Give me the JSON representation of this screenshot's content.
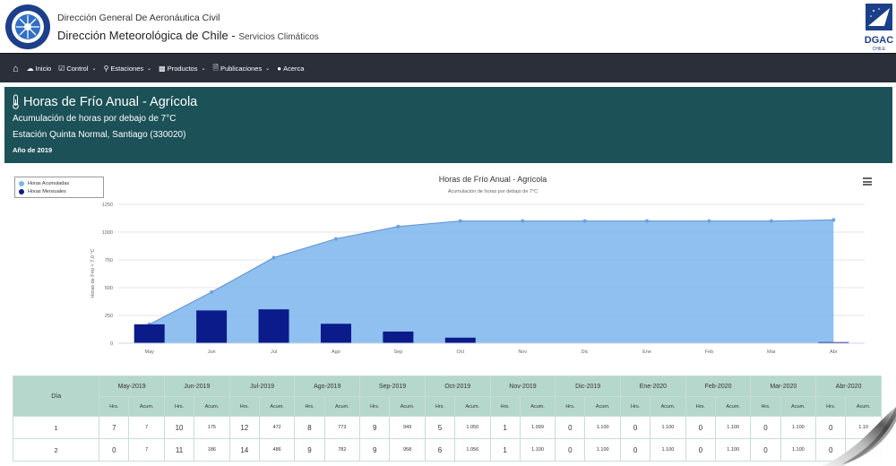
{
  "header": {
    "org_line1": "Dirección General De Aeronáutica Civil",
    "org_line2": "Dirección Meteorológica de Chile",
    "org_sep": " - ",
    "services": "Servicios Climáticos",
    "right_logo_text": "DGAC",
    "right_logo_sub": "CHILE"
  },
  "nav": {
    "items": [
      {
        "label": "Inicio",
        "icon": "cloud-icon",
        "dropdown": false
      },
      {
        "label": "Control",
        "icon": "check-square-icon",
        "dropdown": true
      },
      {
        "label": "Estaciones",
        "icon": "map-marker-icon",
        "dropdown": true
      },
      {
        "label": "Productos",
        "icon": "bar-chart-icon",
        "dropdown": true
      },
      {
        "label": "Publicaciones",
        "icon": "file-icon",
        "dropdown": true
      },
      {
        "label": "Acerca",
        "icon": "comment-icon",
        "dropdown": false
      }
    ]
  },
  "banner": {
    "title": "Horas de Frío Anual - Agrícola",
    "subtitle": "Acumulación de horas por debajo de 7°C",
    "station": "Estación Quinta Normal, Santiago (330020)",
    "year": "Año de 2019"
  },
  "chart_data": {
    "type": "bar",
    "title": "Horas de Frío Anual - Agrícola",
    "subtitle": "Acumulación de horas por debajo de 7°C",
    "ylabel": "Horas de Frío < 7,0 °C",
    "xlabel": "",
    "ylim": [
      0,
      1250
    ],
    "yticks": [
      0,
      250,
      500,
      750,
      1000,
      1250
    ],
    "categories": [
      "May",
      "Jun",
      "Jul",
      "Ago",
      "Sep",
      "Oct",
      "Nov",
      "Dic",
      "Ene",
      "Feb",
      "Mar",
      "Abr"
    ],
    "series": [
      {
        "name": "Horas Acumuladas",
        "kind": "area",
        "color": "#7cb5ec",
        "values": [
          170,
          460,
          770,
          940,
          1050,
          1100,
          1100,
          1100,
          1100,
          1100,
          1100,
          1110
        ]
      },
      {
        "name": "Horas Mensuales",
        "kind": "bar",
        "color": "#0b1b8a",
        "values": [
          170,
          295,
          305,
          175,
          105,
          50,
          0,
          0,
          0,
          0,
          0,
          10
        ]
      }
    ],
    "legend": "top-left",
    "grid": true
  },
  "table": {
    "day_header": "Día",
    "months": [
      "May-2019",
      "Jun-2019",
      "Jul-2019",
      "Ago-2019",
      "Sep-2019",
      "Oct-2019",
      "Nov-2019",
      "Dic-2019",
      "Ene-2020",
      "Feb-2020",
      "Mar-2020",
      "Abr-2020"
    ],
    "sub_hrs": "Hrs.",
    "sub_acum": "Acum.",
    "rows": [
      {
        "day": "1",
        "cells": [
          [
            "7",
            "7"
          ],
          [
            "10",
            "175"
          ],
          [
            "12",
            "472"
          ],
          [
            "8",
            "773"
          ],
          [
            "9",
            "949"
          ],
          [
            "5",
            "1.050"
          ],
          [
            "1",
            "1.099"
          ],
          [
            "0",
            "1.100"
          ],
          [
            "0",
            "1.100"
          ],
          [
            "0",
            "1.100"
          ],
          [
            "0",
            "1.100"
          ],
          [
            "0",
            "1.10"
          ]
        ]
      },
      {
        "day": "2",
        "cells": [
          [
            "0",
            "7"
          ],
          [
            "11",
            "186"
          ],
          [
            "14",
            "486"
          ],
          [
            "9",
            "782"
          ],
          [
            "9",
            "958"
          ],
          [
            "6",
            "1.056"
          ],
          [
            "1",
            "1.100"
          ],
          [
            "0",
            "1.100"
          ],
          [
            "0",
            "1.100"
          ],
          [
            "0",
            "1.100"
          ],
          [
            "0",
            "1.100"
          ],
          [
            "0",
            "1.10"
          ]
        ]
      }
    ]
  },
  "colors": {
    "nav_bg": "#2a2f3a",
    "banner_bg": "#1b5157",
    "table_header_bg": "#b6d7cc",
    "area": "#7cb5ec",
    "bar": "#0b1b8a"
  }
}
